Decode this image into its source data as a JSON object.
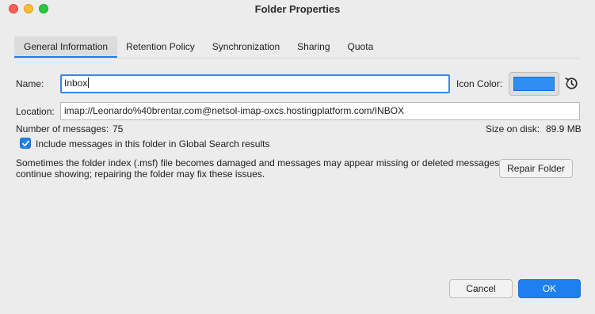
{
  "window": {
    "title": "Folder Properties"
  },
  "tabs": [
    {
      "label": "General Information"
    },
    {
      "label": "Retention Policy"
    },
    {
      "label": "Synchronization"
    },
    {
      "label": "Sharing"
    },
    {
      "label": "Quota"
    }
  ],
  "form": {
    "name_label": "Name:",
    "name_value": "Inbox",
    "icon_color_label": "Icon Color:",
    "icon_color": "#2e8ff0",
    "location_label": "Location:",
    "location_value": "imap://Leonardo%40brentar.com@netsol-imap-oxcs.hostingplatform.com/INBOX",
    "messages_label": "Number of messages:",
    "messages_value": "75",
    "size_label": "Size on disk:",
    "size_value": "89.9 MB",
    "global_search_label": "Include messages in this folder in Global Search results",
    "global_search_checked": true,
    "repair_text_line1": "Sometimes the folder index (.msf) file becomes damaged and messages may appear missing or deleted messages",
    "repair_text_line2": "continue showing; repairing the folder may fix these issues.",
    "repair_button": "Repair Folder"
  },
  "footer": {
    "cancel_label": "Cancel",
    "ok_label": "OK"
  },
  "colors": {
    "accent": "#1e7ff0",
    "window_bg": "#ececec"
  }
}
